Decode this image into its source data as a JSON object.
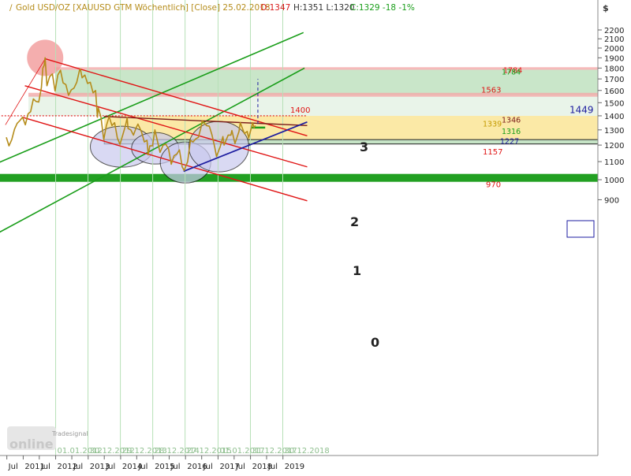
{
  "header": {
    "title": "Gold USD/OZ [XAUUSD GTM  Wöchentlich] [Close] 25.02.2018",
    "open": "O:1347",
    "hl": "H:1351 L:1320",
    "close": "C:1329 -18 -1%",
    "currency": "$"
  },
  "logo": {
    "brand": "online",
    "sub": "Tradesignal"
  },
  "colors": {
    "price": "#b58c1a",
    "price_label": "#c49a00",
    "red_line": "#e01414",
    "green_line": "#1a9e1a",
    "blue_line": "#1e1ea0",
    "zone_green": "#bfe2bf",
    "zone_yellow": "#fbe9a6",
    "band_red": "#f2a9a9",
    "band_green": "#22a022",
    "grid": "#b7e0b7"
  },
  "chart_data": {
    "type": "line",
    "x_axis": {
      "months": [
        "Jul",
        "2011",
        "Jul",
        "2012",
        "Jul",
        "2013",
        "Jul",
        "2014",
        "Jul",
        "2015",
        "Jul",
        "2016",
        "Jul",
        "2017",
        "Jul",
        "2018",
        "Jul",
        "2019"
      ],
      "dates": [
        "01.01.2012",
        "30.12.2012",
        "29.12.2013",
        "28.12.2014",
        "27.12.2015",
        "01.01.2017",
        "31.12.2017",
        "30.12.2018"
      ]
    },
    "y_axis": {
      "ticks": [
        900,
        1000,
        1100,
        1200,
        1300,
        1400,
        1500,
        1600,
        1700,
        1800,
        1900,
        2000,
        2100,
        2200
      ],
      "scale": "log",
      "ylim": [
        880,
        2280
      ]
    },
    "grid": true,
    "series": [
      {
        "values": [
          [
            "2010-06-25",
            1250
          ],
          [
            "2010-07-25",
            1195
          ],
          [
            "2010-08-25",
            1235
          ],
          [
            "2010-09-25",
            1305
          ],
          [
            "2010-10-25",
            1345
          ],
          [
            "2010-11-25",
            1365
          ],
          [
            "2010-12-25",
            1390
          ],
          [
            "2011-01-25",
            1335
          ],
          [
            "2011-02-25",
            1415
          ],
          [
            "2011-03-25",
            1430
          ],
          [
            "2011-04-25",
            1530
          ],
          [
            "2011-05-25",
            1510
          ],
          [
            "2011-06-25",
            1505
          ],
          [
            "2011-07-25",
            1625
          ],
          [
            "2011-08-10",
            1800
          ],
          [
            "2011-08-25",
            1825
          ],
          [
            "2011-09-05",
            1900
          ],
          [
            "2011-09-25",
            1640
          ],
          [
            "2011-10-25",
            1720
          ],
          [
            "2011-11-25",
            1745
          ],
          [
            "2011-12-25",
            1595
          ],
          [
            "2012-01-25",
            1735
          ],
          [
            "2012-02-25",
            1780
          ],
          [
            "2012-03-25",
            1665
          ],
          [
            "2012-04-25",
            1650
          ],
          [
            "2012-05-25",
            1560
          ],
          [
            "2012-06-25",
            1605
          ],
          [
            "2012-07-25",
            1620
          ],
          [
            "2012-08-25",
            1670
          ],
          [
            "2012-09-25",
            1780
          ],
          [
            "2012-10-05",
            1790
          ],
          [
            "2012-10-25",
            1710
          ],
          [
            "2012-11-25",
            1735
          ],
          [
            "2012-12-25",
            1660
          ],
          [
            "2013-01-25",
            1670
          ],
          [
            "2013-02-25",
            1580
          ],
          [
            "2013-03-25",
            1600
          ],
          [
            "2013-04-15",
            1390
          ],
          [
            "2013-04-25",
            1460
          ],
          [
            "2013-05-25",
            1390
          ],
          [
            "2013-06-25",
            1235
          ],
          [
            "2013-07-25",
            1330
          ],
          [
            "2013-08-25",
            1395
          ],
          [
            "2013-09-25",
            1330
          ],
          [
            "2013-10-25",
            1350
          ],
          [
            "2013-11-25",
            1245
          ],
          [
            "2013-12-25",
            1205
          ],
          [
            "2014-01-25",
            1265
          ],
          [
            "2014-02-25",
            1330
          ],
          [
            "2014-03-15",
            1385
          ],
          [
            "2014-03-25",
            1310
          ],
          [
            "2014-04-25",
            1300
          ],
          [
            "2014-05-25",
            1265
          ],
          [
            "2014-06-25",
            1315
          ],
          [
            "2014-07-15",
            1340
          ],
          [
            "2014-08-25",
            1285
          ],
          [
            "2014-09-25",
            1220
          ],
          [
            "2014-10-25",
            1230
          ],
          [
            "2014-11-07",
            1140
          ],
          [
            "2014-11-25",
            1195
          ],
          [
            "2014-12-25",
            1195
          ],
          [
            "2015-01-22",
            1300
          ],
          [
            "2015-02-25",
            1210
          ],
          [
            "2015-03-20",
            1155
          ],
          [
            "2015-04-25",
            1200
          ],
          [
            "2015-05-25",
            1205
          ],
          [
            "2015-06-25",
            1175
          ],
          [
            "2015-07-24",
            1085
          ],
          [
            "2015-08-25",
            1135
          ],
          [
            "2015-09-25",
            1145
          ],
          [
            "2015-10-25",
            1170
          ],
          [
            "2015-11-25",
            1070
          ],
          [
            "2015-12-17",
            1050
          ],
          [
            "2016-01-25",
            1100
          ],
          [
            "2016-02-25",
            1230
          ],
          [
            "2016-03-25",
            1220
          ],
          [
            "2016-04-25",
            1240
          ],
          [
            "2016-05-25",
            1250
          ],
          [
            "2016-06-25",
            1320
          ],
          [
            "2016-07-06",
            1365
          ],
          [
            "2016-08-25",
            1330
          ],
          [
            "2016-09-25",
            1325
          ],
          [
            "2016-10-25",
            1265
          ],
          [
            "2016-11-25",
            1185
          ],
          [
            "2016-12-15",
            1130
          ],
          [
            "2017-01-25",
            1190
          ],
          [
            "2017-02-25",
            1255
          ],
          [
            "2017-03-10",
            1200
          ],
          [
            "2017-04-25",
            1265
          ],
          [
            "2017-05-25",
            1265
          ],
          [
            "2017-06-06",
            1295
          ],
          [
            "2017-07-10",
            1210
          ],
          [
            "2017-08-25",
            1290
          ],
          [
            "2017-09-08",
            1350
          ],
          [
            "2017-10-25",
            1275
          ],
          [
            "2017-11-25",
            1290
          ],
          [
            "2017-12-12",
            1245
          ],
          [
            "2018-01-25",
            1350
          ],
          [
            "2018-02-10",
            1315
          ],
          [
            "2018-02-25",
            1330
          ]
        ]
      }
    ],
    "levels": [
      {
        "label": "970",
        "value": 970
      },
      {
        "label": "1157",
        "value": 1157
      },
      {
        "label": "1227",
        "value": 1227
      },
      {
        "label": "1316",
        "value": 1316
      },
      {
        "label": "1346",
        "value": 1346
      },
      {
        "label": "1400",
        "value": 1400
      },
      {
        "label": "1563",
        "value": 1563
      },
      {
        "label": "1784",
        "value": 1784
      }
    ],
    "annotations": [
      {
        "label": "0"
      },
      {
        "label": "1"
      },
      {
        "label": "2"
      },
      {
        "label": "3"
      },
      {
        "label": "1449",
        "value": 1449
      },
      {
        "label": "1339",
        "value": 1339
      }
    ]
  }
}
